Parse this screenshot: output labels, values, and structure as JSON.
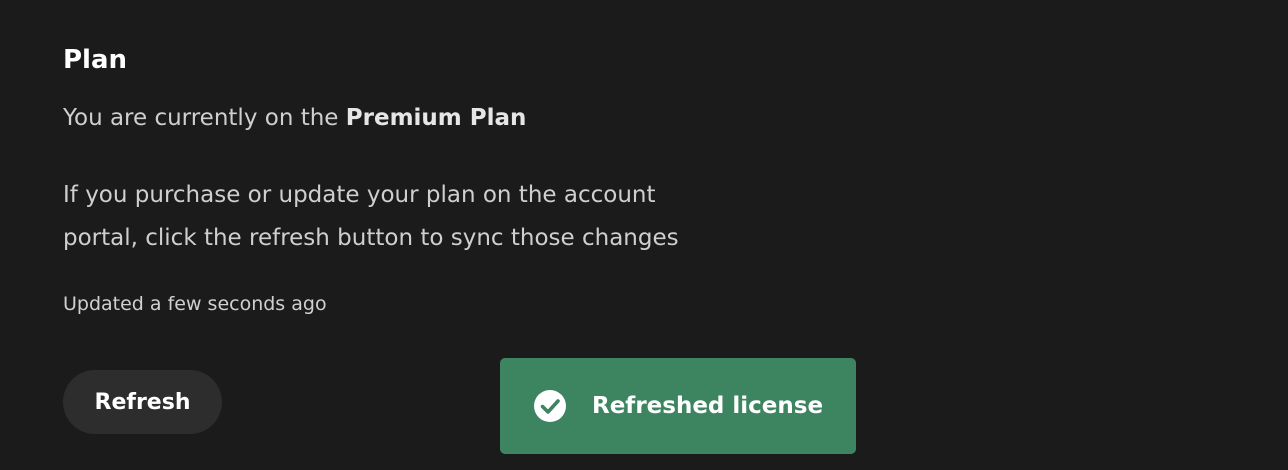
{
  "plan": {
    "title": "Plan",
    "current_prefix": "You are currently on the ",
    "current_plan_name": "Premium Plan",
    "description": "If you purchase or update your plan on the account portal, click the refresh button to sync those changes",
    "updated_text": "Updated a few seconds ago",
    "refresh_label": "Refresh"
  },
  "toast": {
    "message": "Refreshed license",
    "icon": "check-circle-icon",
    "color": "#3d8461"
  },
  "colors": {
    "background": "#1b1b1b",
    "button_background": "#2d2d2d"
  }
}
